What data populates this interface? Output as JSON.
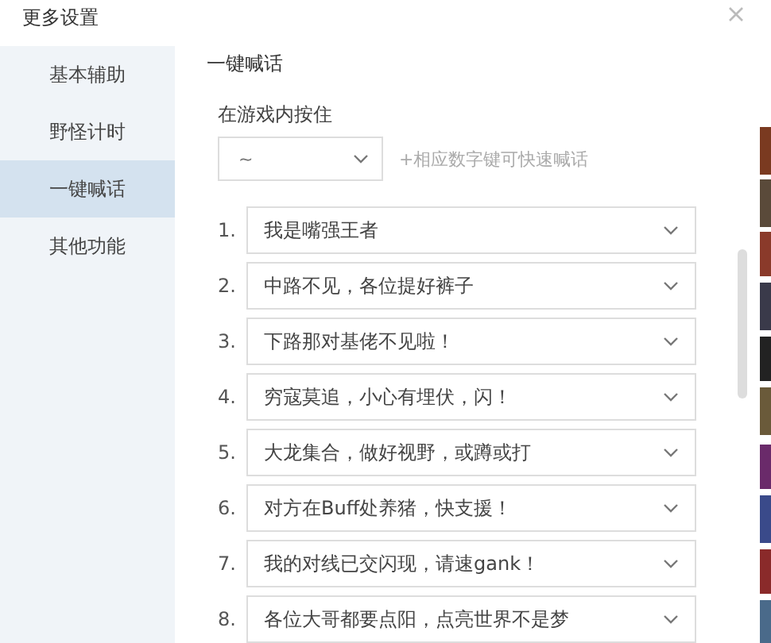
{
  "header": {
    "title": "更多设置"
  },
  "sidebar": {
    "items": [
      {
        "label": "基本辅助",
        "selected": false
      },
      {
        "label": "野怪计时",
        "selected": false
      },
      {
        "label": "一键喊话",
        "selected": true
      },
      {
        "label": "其他功能",
        "selected": false
      }
    ]
  },
  "section": {
    "title": "一键喊话",
    "key_label": "在游戏内按住",
    "key_value": "~",
    "hint": "+相应数字键可快速喊话"
  },
  "phrases": [
    {
      "number": "1.",
      "text": "我是嘴强王者"
    },
    {
      "number": "2.",
      "text": "中路不见，各位提好裤子"
    },
    {
      "number": "3.",
      "text": "下路那对基佬不见啦！"
    },
    {
      "number": "4.",
      "text": "穷寇莫追，小心有埋伏，闪！"
    },
    {
      "number": "5.",
      "text": "大龙集合，做好视野，或蹲或打"
    },
    {
      "number": "6.",
      "text": "对方在Buff处养猪，快支援！"
    },
    {
      "number": "7.",
      "text": "我的对线已交闪现，请速gank！"
    },
    {
      "number": "8.",
      "text": "各位大哥都要点阳，点亮世界不是梦"
    }
  ]
}
